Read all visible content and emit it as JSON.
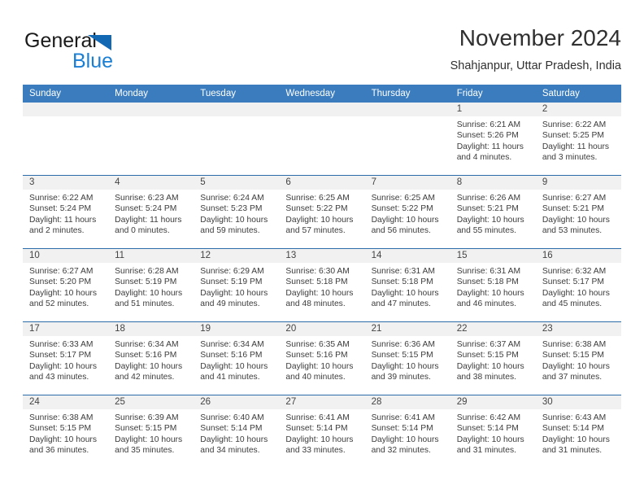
{
  "brand": {
    "name_part1": "General",
    "name_part2": "Blue",
    "logo_icon": "triangle-icon",
    "accent_color": "#1268b3",
    "text_color": "#1a7fd4"
  },
  "header": {
    "month_title": "November 2024",
    "location": "Shahjanpur, Uttar Pradesh, India"
  },
  "calendar": {
    "header_bg": "#3a7cbe",
    "weekday_names": [
      "Sunday",
      "Monday",
      "Tuesday",
      "Wednesday",
      "Thursday",
      "Friday",
      "Saturday"
    ],
    "weeks": [
      [
        {
          "day": "",
          "empty": true,
          "sunrise": "",
          "sunset": "",
          "daylight": ""
        },
        {
          "day": "",
          "empty": true,
          "sunrise": "",
          "sunset": "",
          "daylight": ""
        },
        {
          "day": "",
          "empty": true,
          "sunrise": "",
          "sunset": "",
          "daylight": ""
        },
        {
          "day": "",
          "empty": true,
          "sunrise": "",
          "sunset": "",
          "daylight": ""
        },
        {
          "day": "",
          "empty": true,
          "sunrise": "",
          "sunset": "",
          "daylight": ""
        },
        {
          "day": "1",
          "sunrise": "Sunrise: 6:21 AM",
          "sunset": "Sunset: 5:26 PM",
          "daylight": "Daylight: 11 hours and 4 minutes."
        },
        {
          "day": "2",
          "sunrise": "Sunrise: 6:22 AM",
          "sunset": "Sunset: 5:25 PM",
          "daylight": "Daylight: 11 hours and 3 minutes."
        }
      ],
      [
        {
          "day": "3",
          "sunrise": "Sunrise: 6:22 AM",
          "sunset": "Sunset: 5:24 PM",
          "daylight": "Daylight: 11 hours and 2 minutes."
        },
        {
          "day": "4",
          "sunrise": "Sunrise: 6:23 AM",
          "sunset": "Sunset: 5:24 PM",
          "daylight": "Daylight: 11 hours and 0 minutes."
        },
        {
          "day": "5",
          "sunrise": "Sunrise: 6:24 AM",
          "sunset": "Sunset: 5:23 PM",
          "daylight": "Daylight: 10 hours and 59 minutes."
        },
        {
          "day": "6",
          "sunrise": "Sunrise: 6:25 AM",
          "sunset": "Sunset: 5:22 PM",
          "daylight": "Daylight: 10 hours and 57 minutes."
        },
        {
          "day": "7",
          "sunrise": "Sunrise: 6:25 AM",
          "sunset": "Sunset: 5:22 PM",
          "daylight": "Daylight: 10 hours and 56 minutes."
        },
        {
          "day": "8",
          "sunrise": "Sunrise: 6:26 AM",
          "sunset": "Sunset: 5:21 PM",
          "daylight": "Daylight: 10 hours and 55 minutes."
        },
        {
          "day": "9",
          "sunrise": "Sunrise: 6:27 AM",
          "sunset": "Sunset: 5:21 PM",
          "daylight": "Daylight: 10 hours and 53 minutes."
        }
      ],
      [
        {
          "day": "10",
          "sunrise": "Sunrise: 6:27 AM",
          "sunset": "Sunset: 5:20 PM",
          "daylight": "Daylight: 10 hours and 52 minutes."
        },
        {
          "day": "11",
          "sunrise": "Sunrise: 6:28 AM",
          "sunset": "Sunset: 5:19 PM",
          "daylight": "Daylight: 10 hours and 51 minutes."
        },
        {
          "day": "12",
          "sunrise": "Sunrise: 6:29 AM",
          "sunset": "Sunset: 5:19 PM",
          "daylight": "Daylight: 10 hours and 49 minutes."
        },
        {
          "day": "13",
          "sunrise": "Sunrise: 6:30 AM",
          "sunset": "Sunset: 5:18 PM",
          "daylight": "Daylight: 10 hours and 48 minutes."
        },
        {
          "day": "14",
          "sunrise": "Sunrise: 6:31 AM",
          "sunset": "Sunset: 5:18 PM",
          "daylight": "Daylight: 10 hours and 47 minutes."
        },
        {
          "day": "15",
          "sunrise": "Sunrise: 6:31 AM",
          "sunset": "Sunset: 5:18 PM",
          "daylight": "Daylight: 10 hours and 46 minutes."
        },
        {
          "day": "16",
          "sunrise": "Sunrise: 6:32 AM",
          "sunset": "Sunset: 5:17 PM",
          "daylight": "Daylight: 10 hours and 45 minutes."
        }
      ],
      [
        {
          "day": "17",
          "sunrise": "Sunrise: 6:33 AM",
          "sunset": "Sunset: 5:17 PM",
          "daylight": "Daylight: 10 hours and 43 minutes."
        },
        {
          "day": "18",
          "sunrise": "Sunrise: 6:34 AM",
          "sunset": "Sunset: 5:16 PM",
          "daylight": "Daylight: 10 hours and 42 minutes."
        },
        {
          "day": "19",
          "sunrise": "Sunrise: 6:34 AM",
          "sunset": "Sunset: 5:16 PM",
          "daylight": "Daylight: 10 hours and 41 minutes."
        },
        {
          "day": "20",
          "sunrise": "Sunrise: 6:35 AM",
          "sunset": "Sunset: 5:16 PM",
          "daylight": "Daylight: 10 hours and 40 minutes."
        },
        {
          "day": "21",
          "sunrise": "Sunrise: 6:36 AM",
          "sunset": "Sunset: 5:15 PM",
          "daylight": "Daylight: 10 hours and 39 minutes."
        },
        {
          "day": "22",
          "sunrise": "Sunrise: 6:37 AM",
          "sunset": "Sunset: 5:15 PM",
          "daylight": "Daylight: 10 hours and 38 minutes."
        },
        {
          "day": "23",
          "sunrise": "Sunrise: 6:38 AM",
          "sunset": "Sunset: 5:15 PM",
          "daylight": "Daylight: 10 hours and 37 minutes."
        }
      ],
      [
        {
          "day": "24",
          "sunrise": "Sunrise: 6:38 AM",
          "sunset": "Sunset: 5:15 PM",
          "daylight": "Daylight: 10 hours and 36 minutes."
        },
        {
          "day": "25",
          "sunrise": "Sunrise: 6:39 AM",
          "sunset": "Sunset: 5:15 PM",
          "daylight": "Daylight: 10 hours and 35 minutes."
        },
        {
          "day": "26",
          "sunrise": "Sunrise: 6:40 AM",
          "sunset": "Sunset: 5:14 PM",
          "daylight": "Daylight: 10 hours and 34 minutes."
        },
        {
          "day": "27",
          "sunrise": "Sunrise: 6:41 AM",
          "sunset": "Sunset: 5:14 PM",
          "daylight": "Daylight: 10 hours and 33 minutes."
        },
        {
          "day": "28",
          "sunrise": "Sunrise: 6:41 AM",
          "sunset": "Sunset: 5:14 PM",
          "daylight": "Daylight: 10 hours and 32 minutes."
        },
        {
          "day": "29",
          "sunrise": "Sunrise: 6:42 AM",
          "sunset": "Sunset: 5:14 PM",
          "daylight": "Daylight: 10 hours and 31 minutes."
        },
        {
          "day": "30",
          "sunrise": "Sunrise: 6:43 AM",
          "sunset": "Sunset: 5:14 PM",
          "daylight": "Daylight: 10 hours and 31 minutes."
        }
      ]
    ]
  }
}
